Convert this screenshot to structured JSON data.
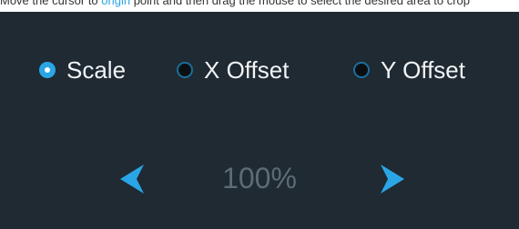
{
  "top_text": {
    "before": "Move the cursor to ",
    "link": "origin",
    "after": " point and then drag the mouse to select the desired area to crop"
  },
  "adjust_modes": [
    {
      "label": "Scale",
      "selected": true
    },
    {
      "label": "X Offset",
      "selected": false
    },
    {
      "label": "Y Offset",
      "selected": false
    }
  ],
  "scale_control": {
    "value": "100%",
    "left_icon": "chevron-left-icon",
    "right_icon": "chevron-right-icon"
  },
  "colors": {
    "panel_bg": "#1f2a33",
    "accent": "#2aa6e6",
    "value_text": "#5d6b74",
    "label_text": "#f2f4f5"
  }
}
